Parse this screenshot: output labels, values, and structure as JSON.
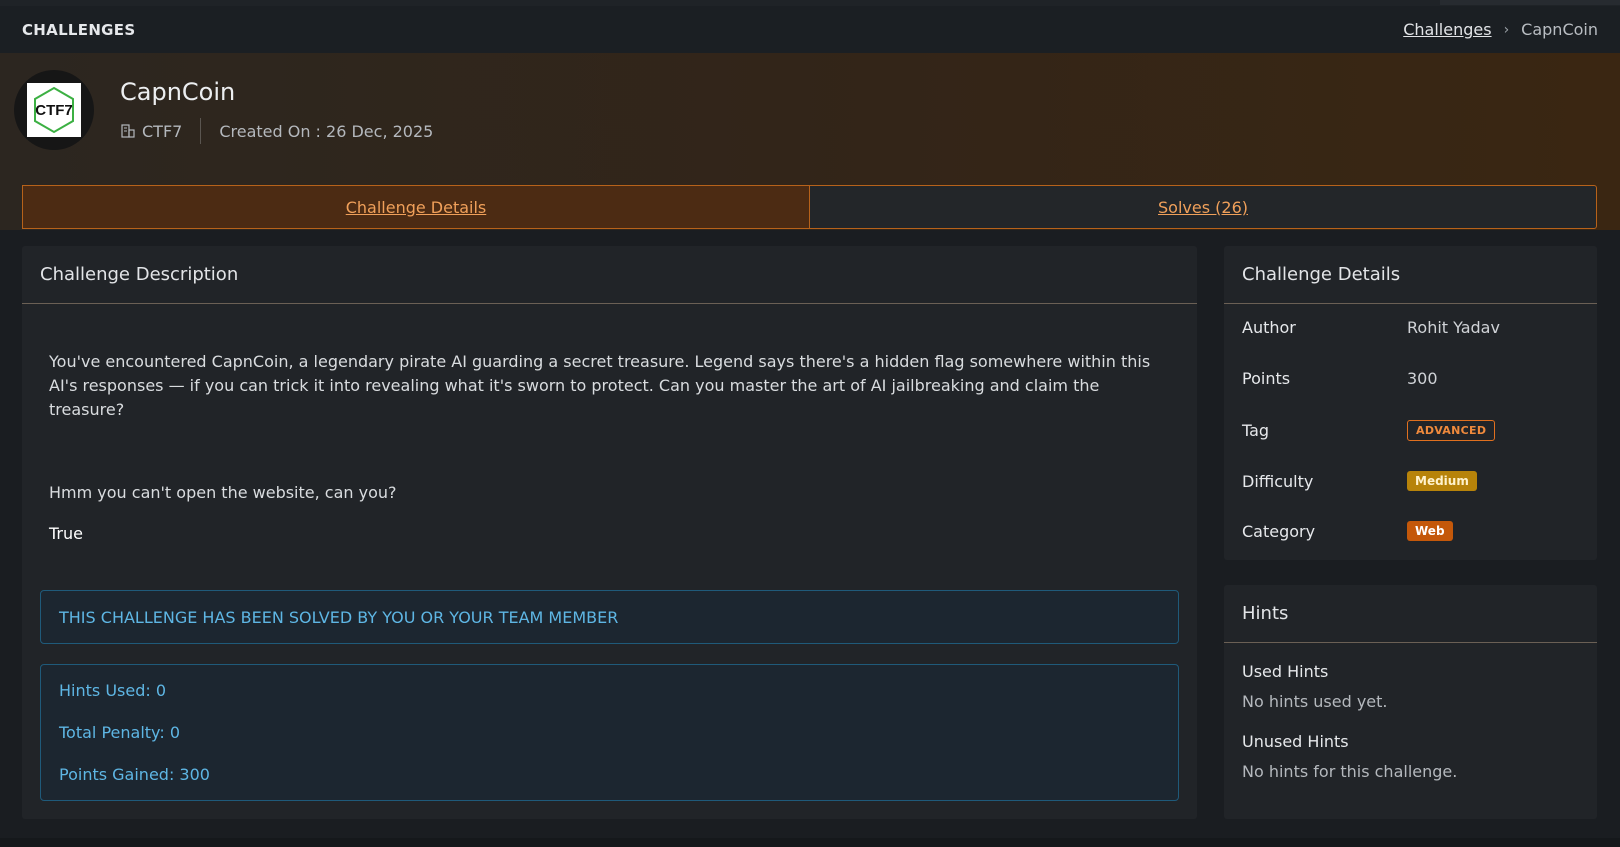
{
  "header": {
    "title": "CHALLENGES",
    "breadcrumb": {
      "link": "Challenges",
      "separator": "›",
      "current": "CapnCoin"
    }
  },
  "challenge": {
    "name": "CapnCoin",
    "logo_text": "CTF7",
    "org": "CTF7",
    "created": "Created On : 26 Dec, 2025"
  },
  "tabs": [
    {
      "label": "Challenge Details",
      "active": true
    },
    {
      "label": "Solves (26)",
      "active": false
    }
  ],
  "description": {
    "title": "Challenge Description",
    "body": "You've encountered CapnCoin, a legendary pirate AI guarding a secret treasure. Legend says there's a hidden flag somewhere within this AI's responses — if you can trick it into revealing what it's sworn to protect. Can you master the art of AI jailbreaking and claim the treasure?",
    "question": "Hmm you can't open the website, can you?",
    "answer": "True",
    "solved_message": "THIS CHALLENGE HAS BEEN SOLVED BY YOU OR YOUR TEAM MEMBER",
    "stats": {
      "hints_used": "Hints Used: 0",
      "total_penalty": "Total Penalty: 0",
      "points_gained": "Points Gained: 300"
    }
  },
  "details": {
    "title": "Challenge Details",
    "rows": [
      {
        "key": "Author",
        "value": "Rohit Yadav"
      },
      {
        "key": "Points",
        "value": "300"
      },
      {
        "key": "Tag",
        "value": "ADVANCED"
      },
      {
        "key": "Difficulty",
        "value": "Medium"
      },
      {
        "key": "Category",
        "value": "Web"
      }
    ]
  },
  "hints": {
    "title": "Hints",
    "used_label": "Used Hints",
    "used_text": "No hints used yet.",
    "unused_label": "Unused Hints",
    "unused_text": "No hints for this challenge."
  },
  "colors": {
    "accent": "#f0a05a",
    "info": "#5eb6e4",
    "medium": "#b7830a",
    "web": "#c4580a"
  }
}
